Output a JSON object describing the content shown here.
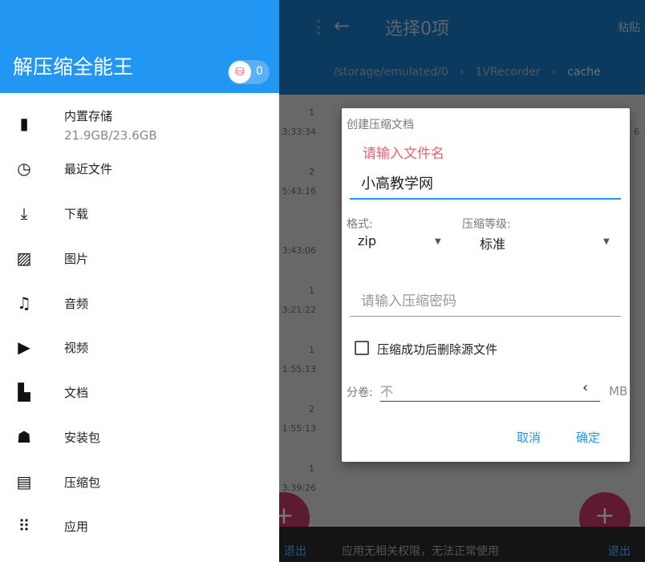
{
  "appbar": {
    "title": "选择0项",
    "paste": "粘贴",
    "breadcrumb": [
      "/storage/emulated/0",
      "1VRecorder",
      "cache"
    ]
  },
  "rows": [
    {
      "n": "1",
      "t": "3:33:34"
    },
    {
      "n": "2",
      "t": "5:43:16"
    },
    {
      "n": "",
      "t": "3:43:06"
    },
    {
      "n": "1",
      "t": "3:21:22"
    },
    {
      "n": "1",
      "t": "1:55:13"
    },
    {
      "n": "2",
      "t": "1:55:13"
    },
    {
      "n": "1",
      "t": "3:39:26"
    }
  ],
  "right_count": "6",
  "bottom": {
    "message": "应用无相关权限，无法正常使用",
    "exit_left": "退出",
    "exit_right": "退出"
  },
  "drawer": {
    "title": "解压缩全能王",
    "toggle_count": "0",
    "items": [
      {
        "label": "内置存储",
        "sub": "21.9GB/23.6GB",
        "icon": "sd-card-icon"
      },
      {
        "label": "最近文件",
        "icon": "clock-icon"
      },
      {
        "label": "下载",
        "icon": "download-icon"
      },
      {
        "label": "图片",
        "icon": "image-icon"
      },
      {
        "label": "音频",
        "icon": "music-icon"
      },
      {
        "label": "视频",
        "icon": "video-icon"
      },
      {
        "label": "文档",
        "icon": "document-icon"
      },
      {
        "label": "安装包",
        "icon": "android-icon"
      },
      {
        "label": "压缩包",
        "icon": "zip-icon"
      },
      {
        "label": "应用",
        "icon": "apps-grid-icon"
      }
    ]
  },
  "dialog": {
    "title": "创建压缩文档",
    "filename_hint": "请输入文件名",
    "filename": "小高教学网",
    "format_label": "格式:",
    "format_value": "zip",
    "level_label": "压缩等级:",
    "level_value": "标准",
    "password_placeholder": "请输入压缩密码",
    "delete_source_label": "压缩成功后删除源文件",
    "delete_source_checked": false,
    "split_label": "分卷:",
    "split_value": "不",
    "split_unit": "MB",
    "cancel": "取消",
    "ok": "确定"
  },
  "colors": {
    "primary": "#2196f3",
    "hint": "#e8606e"
  }
}
